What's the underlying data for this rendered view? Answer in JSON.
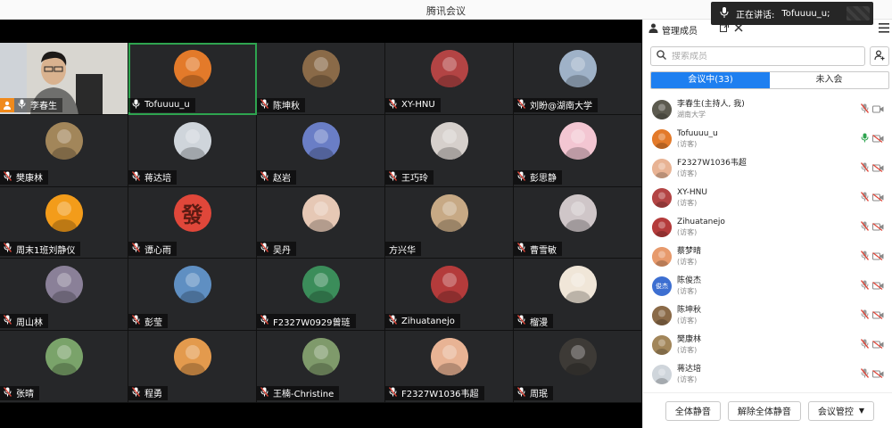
{
  "window": {
    "title": "腾讯会议"
  },
  "speaking": {
    "label": "正在讲话:",
    "name": "Tofuuuu_u;"
  },
  "grid": [
    {
      "name": "李春生",
      "self": true,
      "host": true,
      "muted": false,
      "avatar": "photo-person"
    },
    {
      "name": "Tofuuuu_u",
      "active": true,
      "muted": false,
      "avatar": "tiger",
      "bg": "#e37a2a"
    },
    {
      "name": "陈坤秋",
      "muted": true,
      "avatar": "tree",
      "bg": "#8a6a48"
    },
    {
      "name": "XY-HNU",
      "muted": true,
      "avatar": "trees-red",
      "bg": "#b34444"
    },
    {
      "name": "刘盼@湖南大学",
      "muted": true,
      "avatar": "lake",
      "bg": "#9fb2c8"
    },
    {
      "name": "樊康林",
      "muted": true,
      "avatar": "cartoon-girl",
      "bg": "#a2865a"
    },
    {
      "name": "蒋达培",
      "muted": true,
      "avatar": "anime-boy",
      "bg": "#cfd5db"
    },
    {
      "name": "赵岩",
      "muted": true,
      "avatar": "city-lights",
      "bg": "#6a7ec6"
    },
    {
      "name": "王巧玲",
      "muted": true,
      "avatar": "girl-standing",
      "bg": "#d6d0cc"
    },
    {
      "name": "彭思静",
      "muted": true,
      "avatar": "flowers",
      "bg": "#f3c6d2"
    },
    {
      "name": "周末1班刘静仪",
      "muted": true,
      "avatar": "orange",
      "bg": "#f39c1a"
    },
    {
      "name": "谭心雨",
      "muted": true,
      "avatar": "fa-char",
      "bg": "#e0473a",
      "glyph": "發"
    },
    {
      "name": "吴丹",
      "muted": true,
      "avatar": "baby",
      "bg": "#e6c8b5"
    },
    {
      "name": "方兴华",
      "muted": false,
      "avatar": "cat-photo",
      "bg": "#c7a985"
    },
    {
      "name": "曹雪敏",
      "muted": true,
      "avatar": "anime-girl",
      "bg": "#cfc6c8"
    },
    {
      "name": "周山林",
      "muted": true,
      "avatar": "anime-dark",
      "bg": "#8a8098"
    },
    {
      "name": "彭莹",
      "muted": true,
      "avatar": "mountain",
      "bg": "#5f8fc2"
    },
    {
      "name": "F2327W0929曾琏",
      "muted": true,
      "avatar": "man-green",
      "bg": "#3b8d5a"
    },
    {
      "name": "Zihuatanejo",
      "muted": true,
      "avatar": "collage",
      "bg": "#b43b3b"
    },
    {
      "name": "榴漫",
      "muted": true,
      "avatar": "bear-cartoon",
      "bg": "#f0e6d8"
    },
    {
      "name": "张晴",
      "muted": true,
      "avatar": "panda",
      "bg": "#7aa36a"
    },
    {
      "name": "程勇",
      "muted": true,
      "avatar": "orange-cat",
      "bg": "#e39a4d"
    },
    {
      "name": "王楠-Christine",
      "muted": true,
      "avatar": "outdoor",
      "bg": "#7f9a6b"
    },
    {
      "name": "F2327W1036韦超",
      "muted": true,
      "avatar": "baby-2",
      "bg": "#e8b394"
    },
    {
      "name": "周珉",
      "muted": true,
      "avatar": "dark-arch",
      "bg": "#3d3a36"
    }
  ],
  "panel": {
    "title": "管理成员",
    "search_placeholder": "搜索成员",
    "tabs": [
      {
        "label": "会议中(33)",
        "active": true
      },
      {
        "label": "未入会",
        "active": false
      }
    ],
    "members": [
      {
        "name": "李春生(主持人, 我)",
        "sub": "湖南大学",
        "mic": "muted",
        "bg": "#5c5a4f"
      },
      {
        "name": "Tofuuuu_u",
        "sub": "(访客)",
        "mic": "on",
        "bg": "#e37a2a"
      },
      {
        "name": "F2327W1036韦超",
        "sub": "(访客)",
        "mic": "muted",
        "bg": "#e8b394"
      },
      {
        "name": "XY-HNU",
        "sub": "(访客)",
        "mic": "muted",
        "bg": "#b34444"
      },
      {
        "name": "Zihuatanejo",
        "sub": "(访客)",
        "mic": "muted",
        "bg": "#b43b3b"
      },
      {
        "name": "蔡梦晴",
        "sub": "(访客)",
        "mic": "muted",
        "bg": "#e79a6c"
      },
      {
        "name": "陈俊杰",
        "sub": "(访客)",
        "mic": "muted",
        "bg": "#3d6fd1",
        "glyph": "俊杰"
      },
      {
        "name": "陈坤秋",
        "sub": "(访客)",
        "mic": "muted",
        "bg": "#8a6a48"
      },
      {
        "name": "樊康林",
        "sub": "(访客)",
        "mic": "muted",
        "bg": "#a2865a"
      },
      {
        "name": "蒋达培",
        "sub": "(访客)",
        "mic": "muted",
        "bg": "#cfd5db"
      }
    ],
    "footer": {
      "mute_all": "全体静音",
      "unmute_all": "解除全体静音",
      "control": "会议管控"
    }
  },
  "colors": {
    "accent": "#1e7ff0",
    "active_border": "#2ea44f",
    "host_badge": "#f08a1c",
    "mic_on": "#2ea44f",
    "mic_muted": "#e0473a"
  }
}
